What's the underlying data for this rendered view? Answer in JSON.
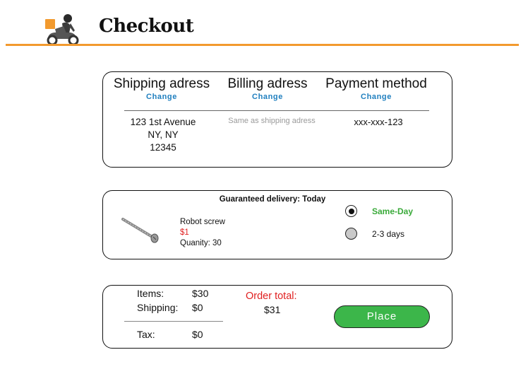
{
  "header": {
    "title": "Checkout",
    "logo_icon": "delivery-scooter-icon",
    "accent_color": "#f29a2e"
  },
  "addresses": {
    "shipping": {
      "title": "Shipping adress",
      "change_label": "Change",
      "lines": [
        "123 1st Avenue",
        "NY, NY",
        "12345"
      ]
    },
    "billing": {
      "title": "Billing adress",
      "change_label": "Change",
      "value": "Same as shipping adress"
    },
    "payment": {
      "title": "Payment method",
      "change_label": "Change",
      "value": "xxx-xxx-123"
    }
  },
  "delivery": {
    "guarantee": "Guaranteed delivery: Today",
    "product": {
      "icon": "screw-icon",
      "name": "Robot screw",
      "price": "$1",
      "quantity": "Quanity: 30"
    },
    "options": [
      {
        "label": "Same-Day",
        "selected": true
      },
      {
        "label": "2-3 days",
        "selected": false
      }
    ]
  },
  "summary": {
    "items_label": "Items:",
    "items_value": "$30",
    "shipping_label": "Shipping:",
    "shipping_value": "$0",
    "tax_label": "Tax:",
    "tax_value": "$0",
    "order_total_label": "Order total:",
    "order_total_value": "$31",
    "place_label": "Place"
  }
}
